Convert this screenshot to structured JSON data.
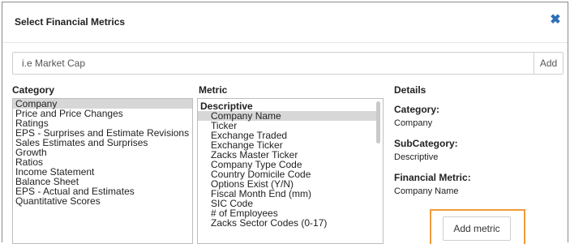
{
  "dialog": {
    "title": "Select Financial Metrics",
    "close_icon": "close-icon",
    "close_color": "#2e6fb5"
  },
  "search": {
    "placeholder": "i.e Market Cap",
    "value": "",
    "add_label": "Add"
  },
  "category": {
    "heading": "Category",
    "items": [
      "Company",
      "Price and Price Changes",
      "Ratings",
      "EPS - Surprises and Estimate Revisions",
      "Sales Estimates and Surprises",
      "Growth",
      "Ratios",
      "Income Statement",
      "Balance Sheet",
      "EPS - Actual and Estimates",
      "Quantitative Scores"
    ],
    "selected": "Company"
  },
  "metric": {
    "heading": "Metric",
    "group": "Descriptive",
    "items": [
      "Company Name",
      "Ticker",
      "Exchange Traded",
      "Exchange Ticker",
      "Zacks Master Ticker",
      "Company Type Code",
      "Country Domicile Code",
      "Options Exist (Y/N)",
      "Fiscal Month End (mm)",
      "SIC Code",
      "# of Employees",
      "Zacks Sector Codes (0-17)"
    ],
    "selected": "Company Name"
  },
  "details": {
    "heading": "Details",
    "category_label": "Category:",
    "category_value": "Company",
    "subcategory_label": "SubCategory:",
    "subcategory_value": "Descriptive",
    "metric_label": "Financial Metric:",
    "metric_value": "Company Name"
  },
  "actions": {
    "add_metric_label": "Add metric",
    "highlight_color": "#f29b38"
  }
}
